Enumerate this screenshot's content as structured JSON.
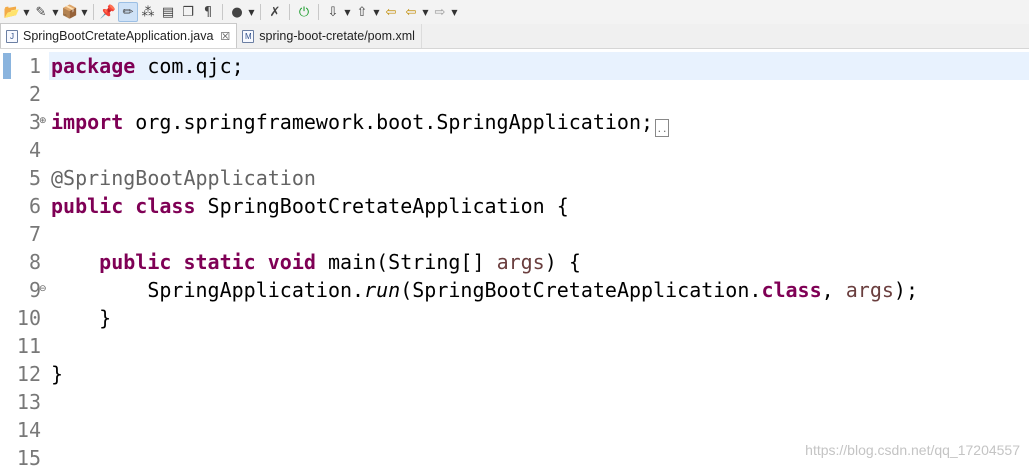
{
  "toolbar": {
    "icons": [
      "open-folder-icon",
      "wand-icon",
      "package-icon",
      "pin-icon",
      "highlight-icon",
      "dots-icon",
      "edit-icon",
      "copy-icon",
      "paragraph-icon",
      "user-icon",
      "pencil-cross-icon",
      "power-icon",
      "arrow-down-icon",
      "arrow-up-icon",
      "back-arrow-icon",
      "forward-arrow-icon"
    ]
  },
  "tabs": [
    {
      "label": "SpringBootCretateApplication.java",
      "icon": "J",
      "close": "☒",
      "active": true
    },
    {
      "label": "spring-boot-cretate/pom.xml",
      "icon": "M",
      "active": false
    }
  ],
  "editor": {
    "line_numbers": [
      "1",
      "2",
      "3",
      "4",
      "5",
      "6",
      "7",
      "8",
      "9",
      "10",
      "11",
      "12",
      "13",
      "14",
      "15"
    ],
    "line1": {
      "kw": "package",
      "rest": " com.qjc;"
    },
    "line3": {
      "kw": "import",
      "rest": " org.springframework.boot.SpringApplication;",
      "fold": "⊕",
      "collapsed": ".."
    },
    "line5": {
      "ann": "@SpringBootApplication"
    },
    "line6": {
      "kw1": "public",
      "kw2": "class",
      "rest": " SpringBootCretateApplication {"
    },
    "line8": {
      "indent": "    ",
      "kw1": "public",
      "kw2": "static",
      "kw3": "void",
      "rest1": " main(String[] ",
      "var": "args",
      "rest2": ") {",
      "fold": "⊖"
    },
    "line9": {
      "indent": "        ",
      "rest1": "SpringApplication.",
      "it": "run",
      "rest2": "(SpringBootCretateApplication.",
      "kw": "class",
      "rest3": ", ",
      "var": "args",
      "rest4": ");"
    },
    "line10": {
      "text": "    }"
    },
    "line12": {
      "text": "}"
    }
  },
  "watermark": "https://blog.csdn.net/qq_17204557"
}
